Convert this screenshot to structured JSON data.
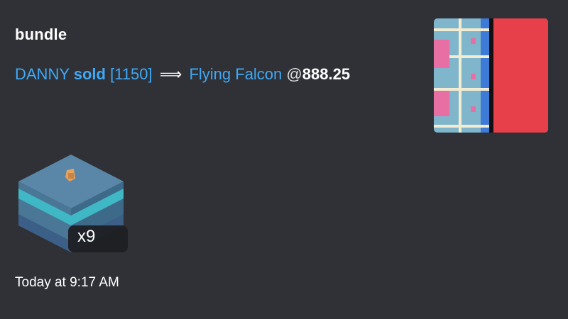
{
  "embed": {
    "title": "bundle",
    "description": {
      "seller": "DANNY",
      "action": "sold",
      "quantity": "[1150]",
      "arrow": "⟹",
      "buyer": "Flying Falcon",
      "at_symbol": "@",
      "price": "888.25"
    },
    "item_badge": "x9",
    "timestamp": "Today at 9:17 AM",
    "thumbnail_icon": "building-pixel-thumbnail",
    "item_icon": "pixel-land-cube-icon"
  },
  "colors": {
    "background": "#2f3136",
    "link": "#3fa9f5",
    "text": "#dcddde",
    "title": "#ffffff",
    "thumbnail_red": "#e8404a"
  }
}
